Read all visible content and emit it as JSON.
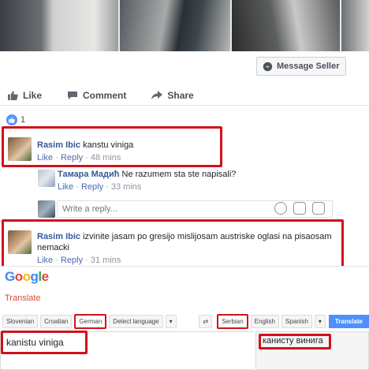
{
  "facebook": {
    "message_seller_label": "Message Seller",
    "actions": {
      "like": "Like",
      "comment": "Comment",
      "share": "Share"
    },
    "like_count": "1",
    "comments": [
      {
        "name": "Rasim Ibic",
        "text": "kanstu viniga",
        "like": "Like",
        "reply": "Reply",
        "time": "48 mins"
      },
      {
        "name": "Тамара Мадић",
        "text": "Ne razumem sta ste napisali?",
        "like": "Like",
        "reply": "Reply",
        "time": "33 mins"
      },
      {
        "name": "Rasim Ibic",
        "text": "izvinite jasam po gresijo mislijosam austriske oglasi na pisaosam nemacki",
        "like": "Like",
        "reply": "Reply",
        "time": "31 mins"
      }
    ],
    "reply_placeholder": "Write a reply..."
  },
  "translate": {
    "logo": "Google",
    "section_label": "Translate",
    "source_langs": [
      "Slovenian",
      "Croatian",
      "German",
      "Detect language"
    ],
    "target_langs": [
      "Serbian",
      "English",
      "Spanish"
    ],
    "translate_button": "Translate",
    "source_text": "kanistu viniga",
    "result_text": "канисту винига"
  },
  "colors": {
    "highlight": "#d0121a",
    "fb_link": "#365899",
    "google_red": "#dd4b39"
  }
}
